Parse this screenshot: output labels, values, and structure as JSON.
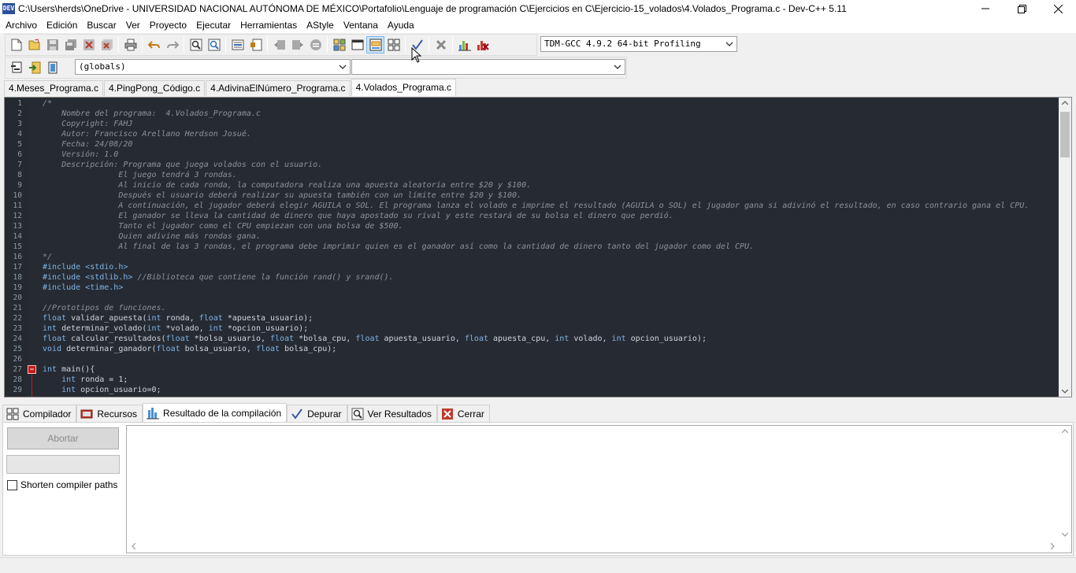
{
  "window": {
    "title": "C:\\Users\\herds\\OneDrive - UNIVERSIDAD NACIONAL AUTÓNOMA DE MÉXICO\\Portafolio\\Lenguaje de programación C\\Ejercicios en C\\Ejercicio-15_volados\\4.Volados_Programa.c - Dev-C++ 5.11",
    "app_icon": "DEV"
  },
  "menu": [
    "Archivo",
    "Edición",
    "Buscar",
    "Ver",
    "Proyecto",
    "Ejecutar",
    "Herramientas",
    "AStyle",
    "Ventana",
    "Ayuda"
  ],
  "toolbar": {
    "compiler_select": "TDM-GCC 4.9.2 64-bit Profiling",
    "globals_select": "(globals)",
    "members_select": ""
  },
  "file_tabs": [
    "4.Meses_Programa.c",
    "4.PingPong_Código.c",
    "4.AdivinaElNúmero_Programa.c",
    "4.Volados_Programa.c"
  ],
  "active_file_tab": 3,
  "editor": {
    "lines": [
      {
        "n": "1",
        "t": "/*"
      },
      {
        "n": "2",
        "t": "    Nombre del programa:  4.Volados_Programa.c"
      },
      {
        "n": "3",
        "t": "    Copyright: FAHJ"
      },
      {
        "n": "4",
        "t": "    Autor: Francisco Arellano Herdson Josué."
      },
      {
        "n": "5",
        "t": "    Fecha: 24/08/20"
      },
      {
        "n": "6",
        "t": "    Versión: 1.0"
      },
      {
        "n": "7",
        "t": "    Descripción: Programa que juega volados con el usuario."
      },
      {
        "n": "8",
        "t": "                El juego tendrá 3 rondas."
      },
      {
        "n": "9",
        "t": "                Al inicio de cada ronda, la computadora realiza una apuesta aleatoria entre $20 y $100."
      },
      {
        "n": "10",
        "t": "                Después el usuario deberá realizar su apuesta también con un límite entre $20 y $100."
      },
      {
        "n": "11",
        "t": "                A continuación, el jugador deberá elegir AGUILA o SOL. El programa lanza el volado e imprime el resultado (AGUILA o SOL) el jugador gana si adivinó el resultado, en caso contrario gana el CPU."
      },
      {
        "n": "12",
        "t": "                El ganador se lleva la cantidad de dinero que haya apostado su rival y este restará de su bolsa el dinero que perdió."
      },
      {
        "n": "13",
        "t": "                Tanto el jugador como el CPU empiezan con una bolsa de $500."
      },
      {
        "n": "14",
        "t": "                Quien adivine más rondas gana."
      },
      {
        "n": "15",
        "t": "                Al final de las 3 rondas, el programa debe imprimir quien es el ganador así como la cantidad de dinero tanto del jugador como del CPU."
      },
      {
        "n": "16",
        "t": "*/"
      },
      {
        "n": "17",
        "t": "#include <stdio.h>"
      },
      {
        "n": "18",
        "t": "#include <stdlib.h> //Biblioteca que contiene la función rand() y srand()."
      },
      {
        "n": "19",
        "t": "#include <time.h>"
      },
      {
        "n": "20",
        "t": ""
      },
      {
        "n": "21",
        "t": "//Prototipos de funciones."
      },
      {
        "n": "22",
        "t": "float validar_apuesta(int ronda, float *apuesta_usuario);"
      },
      {
        "n": "23",
        "t": "int determinar_volado(int *volado, int *opcion_usuario);"
      },
      {
        "n": "24",
        "t": "float calcular_resultados(float *bolsa_usuario, float *bolsa_cpu, float apuesta_usuario, float apuesta_cpu, int volado, int opcion_usuario);"
      },
      {
        "n": "25",
        "t": "void determinar_ganador(float bolsa_usuario, float bolsa_cpu);"
      },
      {
        "n": "26",
        "t": ""
      },
      {
        "n": "27",
        "t": "int main(){"
      },
      {
        "n": "28",
        "t": "    int ronda = 1;"
      },
      {
        "n": "29",
        "t": "    int opcion_usuario=0;"
      }
    ]
  },
  "bottom_tabs": [
    "Compilador",
    "Recursos",
    "Resultado de la compilación",
    "Depurar",
    "Ver Resultados",
    "Cerrar"
  ],
  "active_bottom_tab": 2,
  "compile_panel": {
    "abort_label": "Abortar",
    "shorten_paths_label": "Shorten compiler paths",
    "shorten_paths_checked": false
  },
  "colors": {
    "editor_bg": "#262b33",
    "comment": "#8b929b",
    "keyword": "#7fb3e6",
    "fold_marker": "#c51b1b"
  }
}
